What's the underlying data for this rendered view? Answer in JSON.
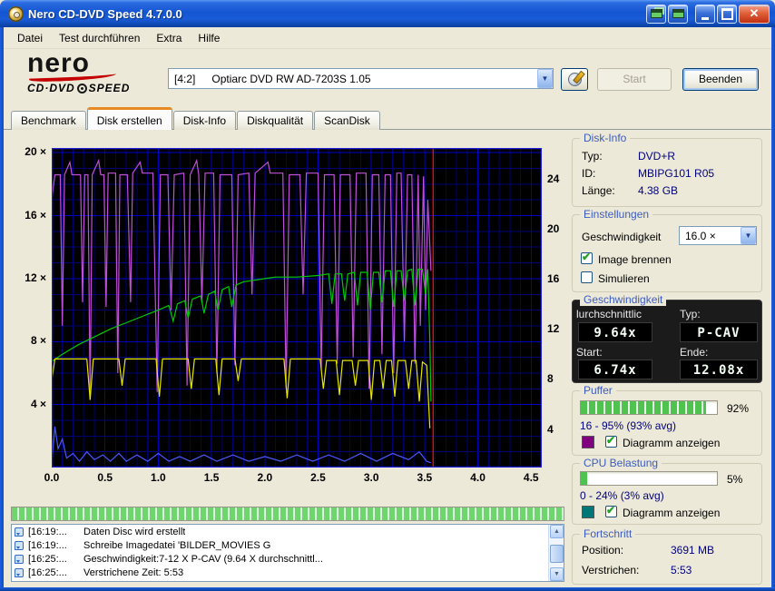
{
  "window": {
    "title": "Nero CD-DVD Speed 4.7.0.0"
  },
  "menu": {
    "items": [
      "Datei",
      "Test durchführen",
      "Extra",
      "Hilfe"
    ]
  },
  "logo": {
    "word": "nero",
    "sub_left": "CD·DVD",
    "sub_right": "SPEED"
  },
  "toolbar": {
    "drive_id": "[4:2]",
    "drive_name": "Optiarc DVD RW AD-7203S 1.05",
    "start_label": "Start",
    "quit_label": "Beenden"
  },
  "tabs": [
    {
      "label": "Benchmark"
    },
    {
      "label": "Disk erstellen"
    },
    {
      "label": "Disk-Info"
    },
    {
      "label": "Diskqualität"
    },
    {
      "label": "ScanDisk"
    }
  ],
  "chart_data": {
    "type": "line",
    "title": "",
    "xlabel": "",
    "ylabel": "",
    "xlim": [
      0,
      4.6
    ],
    "x_ticks": [
      {
        "v": 0.0,
        "label": "0.0"
      },
      {
        "v": 0.5,
        "label": "0.5"
      },
      {
        "v": 1.0,
        "label": "1.0"
      },
      {
        "v": 1.5,
        "label": "1.5"
      },
      {
        "v": 2.0,
        "label": "2.0"
      },
      {
        "v": 2.5,
        "label": "2.5"
      },
      {
        "v": 3.0,
        "label": "3.0"
      },
      {
        "v": 3.5,
        "label": "3.5"
      },
      {
        "v": 4.0,
        "label": "4.0"
      },
      {
        "v": 4.5,
        "label": "4.5"
      }
    ],
    "left_axis": {
      "lim": [
        0,
        20.3
      ],
      "ticks": [
        {
          "v": 4,
          "label": "4 ×"
        },
        {
          "v": 8,
          "label": "8 ×"
        },
        {
          "v": 12,
          "label": "12 ×"
        },
        {
          "v": 16,
          "label": "16 ×"
        },
        {
          "v": 20,
          "label": "20 ×"
        }
      ]
    },
    "right_axis": {
      "lim": [
        1.0,
        26.5
      ],
      "ticks": [
        {
          "v": 4,
          "label": "4"
        },
        {
          "v": 8,
          "label": "8"
        },
        {
          "v": 12,
          "label": "12"
        },
        {
          "v": 16,
          "label": "16"
        },
        {
          "v": 20,
          "label": "20"
        },
        {
          "v": 24,
          "label": "24"
        }
      ]
    },
    "grid": {
      "x_minor": 0.1,
      "x_major": 0.5,
      "y_minor": 1,
      "y_major": 4,
      "minor_color": "#000074",
      "major_color": "#0000c0",
      "border_color": "#2121dd"
    },
    "marker": {
      "x": 3.58,
      "color": "#ff0000"
    },
    "series": [
      {
        "name": "buffer-level",
        "color": "#c050d8",
        "points": [
          [
            0.0,
            17.0
          ],
          [
            0.03,
            18.6
          ],
          [
            0.08,
            18.6
          ],
          [
            0.1,
            9.0
          ],
          [
            0.12,
            18.6
          ],
          [
            0.17,
            19.4
          ],
          [
            0.19,
            18.6
          ],
          [
            0.27,
            18.6
          ],
          [
            0.29,
            10.5
          ],
          [
            0.31,
            18.6
          ],
          [
            0.34,
            18.6
          ],
          [
            0.36,
            4.3
          ],
          [
            0.38,
            18.6
          ],
          [
            0.44,
            19.5
          ],
          [
            0.46,
            18.6
          ],
          [
            0.49,
            18.6
          ],
          [
            0.51,
            10.2
          ],
          [
            0.53,
            18.7
          ],
          [
            0.6,
            18.7
          ],
          [
            0.62,
            6.0
          ],
          [
            0.64,
            18.6
          ],
          [
            0.71,
            18.6
          ],
          [
            0.74,
            10.5
          ],
          [
            0.76,
            18.7
          ],
          [
            0.83,
            19.4
          ],
          [
            0.85,
            18.7
          ],
          [
            0.95,
            18.7
          ],
          [
            0.99,
            4.8
          ],
          [
            1.02,
            18.6
          ],
          [
            1.09,
            18.6
          ],
          [
            1.12,
            10.0
          ],
          [
            1.15,
            18.6
          ],
          [
            1.24,
            18.7
          ],
          [
            1.27,
            5.2
          ],
          [
            1.3,
            18.6
          ],
          [
            1.36,
            19.5
          ],
          [
            1.38,
            18.6
          ],
          [
            1.41,
            10.5
          ],
          [
            1.44,
            18.7
          ],
          [
            1.52,
            18.7
          ],
          [
            1.55,
            6.0
          ],
          [
            1.58,
            18.6
          ],
          [
            1.69,
            18.6
          ],
          [
            1.72,
            6.5
          ],
          [
            1.75,
            18.6
          ],
          [
            1.85,
            18.7
          ],
          [
            1.88,
            11.0
          ],
          [
            1.91,
            18.7
          ],
          [
            2.03,
            19.4
          ],
          [
            2.05,
            18.7
          ],
          [
            2.17,
            18.7
          ],
          [
            2.2,
            5.0
          ],
          [
            2.23,
            18.6
          ],
          [
            2.33,
            18.6
          ],
          [
            2.36,
            11.0
          ],
          [
            2.39,
            18.7
          ],
          [
            2.5,
            18.7
          ],
          [
            2.53,
            6.2
          ],
          [
            2.56,
            18.6
          ],
          [
            2.65,
            18.6
          ],
          [
            2.68,
            6.6
          ],
          [
            2.71,
            18.6
          ],
          [
            2.8,
            18.6
          ],
          [
            2.83,
            7.0
          ],
          [
            2.86,
            18.7
          ],
          [
            2.95,
            18.7
          ],
          [
            2.98,
            5.0
          ],
          [
            3.01,
            18.6
          ],
          [
            3.07,
            18.6
          ],
          [
            3.1,
            7.2
          ],
          [
            3.13,
            18.6
          ],
          [
            3.18,
            18.6
          ],
          [
            3.21,
            6.0
          ],
          [
            3.24,
            18.7
          ],
          [
            3.28,
            18.7
          ],
          [
            3.31,
            8.0
          ],
          [
            3.34,
            18.6
          ],
          [
            3.38,
            18.6
          ],
          [
            3.41,
            6.6
          ],
          [
            3.44,
            18.6
          ],
          [
            3.46,
            9.0
          ],
          [
            3.49,
            18.5
          ],
          [
            3.51,
            10.0
          ],
          [
            3.53,
            17.0
          ],
          [
            3.56,
            12.5
          ]
        ]
      },
      {
        "name": "write-speed",
        "color": "#00cc00",
        "points": [
          [
            0.0,
            6.74
          ],
          [
            0.1,
            7.2
          ],
          [
            0.25,
            7.8
          ],
          [
            0.4,
            8.3
          ],
          [
            0.55,
            8.8
          ],
          [
            0.7,
            9.2
          ],
          [
            0.85,
            9.6
          ],
          [
            1.0,
            10.0
          ],
          [
            1.1,
            10.3
          ],
          [
            1.14,
            9.3
          ],
          [
            1.18,
            10.4
          ],
          [
            1.25,
            10.6
          ],
          [
            1.28,
            9.5
          ],
          [
            1.32,
            10.7
          ],
          [
            1.4,
            10.9
          ],
          [
            1.43,
            9.8
          ],
          [
            1.47,
            11.0
          ],
          [
            1.53,
            11.2
          ],
          [
            1.56,
            10.0
          ],
          [
            1.6,
            11.3
          ],
          [
            1.66,
            11.5
          ],
          [
            1.69,
            10.2
          ],
          [
            1.73,
            11.6
          ],
          [
            1.8,
            11.8
          ],
          [
            1.9,
            11.9
          ],
          [
            2.0,
            12.0
          ],
          [
            2.1,
            12.1
          ],
          [
            2.3,
            12.1
          ],
          [
            2.5,
            12.2
          ],
          [
            2.6,
            12.3
          ],
          [
            2.63,
            10.4
          ],
          [
            2.66,
            12.3
          ],
          [
            2.72,
            12.3
          ],
          [
            2.75,
            10.6
          ],
          [
            2.78,
            12.3
          ],
          [
            2.84,
            12.4
          ],
          [
            2.87,
            10.3
          ],
          [
            2.9,
            12.4
          ],
          [
            2.96,
            12.4
          ],
          [
            2.99,
            10.0
          ],
          [
            3.02,
            12.4
          ],
          [
            3.07,
            12.4
          ],
          [
            3.1,
            10.5
          ],
          [
            3.13,
            12.5
          ],
          [
            3.18,
            12.5
          ],
          [
            3.21,
            10.2
          ],
          [
            3.24,
            12.5
          ],
          [
            3.28,
            12.5
          ],
          [
            3.31,
            10.6
          ],
          [
            3.34,
            12.5
          ],
          [
            3.38,
            12.6
          ],
          [
            3.41,
            10.3
          ],
          [
            3.44,
            12.6
          ],
          [
            3.48,
            12.6
          ],
          [
            3.51,
            11.0
          ],
          [
            3.53,
            12.6
          ],
          [
            3.55,
            8.0
          ],
          [
            3.56,
            4.2
          ]
        ]
      },
      {
        "name": "read-rate",
        "color": "#e6e600",
        "points": [
          [
            0.0,
            5.5
          ],
          [
            0.03,
            6.9
          ],
          [
            0.2,
            6.9
          ],
          [
            0.33,
            6.9
          ],
          [
            0.36,
            4.3
          ],
          [
            0.39,
            6.9
          ],
          [
            0.55,
            6.9
          ],
          [
            0.63,
            6.9
          ],
          [
            0.66,
            5.2
          ],
          [
            0.69,
            6.9
          ],
          [
            0.85,
            6.9
          ],
          [
            0.98,
            6.9
          ],
          [
            1.01,
            4.5
          ],
          [
            1.04,
            6.9
          ],
          [
            1.2,
            6.9
          ],
          [
            1.28,
            6.9
          ],
          [
            1.31,
            5.0
          ],
          [
            1.34,
            6.9
          ],
          [
            1.5,
            6.9
          ],
          [
            1.54,
            6.9
          ],
          [
            1.57,
            4.6
          ],
          [
            1.6,
            6.9
          ],
          [
            1.72,
            6.9
          ],
          [
            1.75,
            5.5
          ],
          [
            1.78,
            6.9
          ],
          [
            2.0,
            6.9
          ],
          [
            2.18,
            6.9
          ],
          [
            2.21,
            4.4
          ],
          [
            2.24,
            6.9
          ],
          [
            2.4,
            6.9
          ],
          [
            2.52,
            6.9
          ],
          [
            2.55,
            5.0
          ],
          [
            2.58,
            6.8
          ],
          [
            2.67,
            6.8
          ],
          [
            2.7,
            4.6
          ],
          [
            2.73,
            6.8
          ],
          [
            2.82,
            6.8
          ],
          [
            2.85,
            5.2
          ],
          [
            2.88,
            6.8
          ],
          [
            2.97,
            6.8
          ],
          [
            3.0,
            4.3
          ],
          [
            3.03,
            6.8
          ],
          [
            3.08,
            6.8
          ],
          [
            3.11,
            5.0
          ],
          [
            3.14,
            6.8
          ],
          [
            3.19,
            6.8
          ],
          [
            3.22,
            4.5
          ],
          [
            3.25,
            6.8
          ],
          [
            3.32,
            6.8
          ],
          [
            3.35,
            5.0
          ],
          [
            3.38,
            6.8
          ],
          [
            3.42,
            6.8
          ],
          [
            3.45,
            4.2
          ],
          [
            3.48,
            6.7
          ],
          [
            3.52,
            6.5
          ],
          [
            3.55,
            2.5
          ]
        ]
      },
      {
        "name": "cpu-usage",
        "color": "#4858ff",
        "points": [
          [
            0.0,
            0.3
          ],
          [
            0.03,
            2.6
          ],
          [
            0.06,
            1.2
          ],
          [
            0.1,
            1.8
          ],
          [
            0.14,
            0.6
          ],
          [
            0.2,
            0.9
          ],
          [
            0.26,
            0.4
          ],
          [
            0.33,
            1.0
          ],
          [
            0.4,
            0.5
          ],
          [
            0.48,
            0.8
          ],
          [
            0.55,
            0.4
          ],
          [
            0.63,
            0.9
          ],
          [
            0.7,
            0.4
          ],
          [
            0.8,
            0.8
          ],
          [
            0.9,
            0.4
          ],
          [
            1.0,
            0.9
          ],
          [
            1.1,
            0.4
          ],
          [
            1.2,
            0.7
          ],
          [
            1.3,
            0.4
          ],
          [
            1.43,
            0.8
          ],
          [
            1.55,
            0.4
          ],
          [
            1.7,
            0.8
          ],
          [
            1.85,
            0.4
          ],
          [
            2.0,
            0.7
          ],
          [
            2.15,
            0.4
          ],
          [
            2.3,
            0.8
          ],
          [
            2.45,
            0.4
          ],
          [
            2.6,
            0.8
          ],
          [
            2.75,
            0.4
          ],
          [
            2.9,
            0.9
          ],
          [
            3.05,
            0.4
          ],
          [
            3.2,
            0.9
          ],
          [
            3.35,
            0.5
          ],
          [
            3.45,
            1.0
          ],
          [
            3.52,
            0.4
          ],
          [
            3.56,
            0.3
          ]
        ]
      }
    ]
  },
  "disk_info": {
    "title": "Disk-Info",
    "rows": [
      {
        "label": "Typ:",
        "value": "DVD+R"
      },
      {
        "label": "ID:",
        "value": "MBIPG101 R05"
      },
      {
        "label": "Länge:",
        "value": "4.38 GB"
      }
    ]
  },
  "settings": {
    "title": "Einstellungen",
    "speed_label": "Geschwindigkeit",
    "speed_value": "16.0 ×",
    "image_burn": "Image brennen",
    "simulate": "Simulieren"
  },
  "speed": {
    "title": "Geschwindigkeit",
    "avg_label": "lurchschnittlic",
    "type_label": "Typ:",
    "avg_value": "9.64x",
    "type_value": "P-CAV",
    "start_label": "Start:",
    "end_label": "Ende:",
    "start_value": "6.74x",
    "end_value": "12.08x"
  },
  "buffer": {
    "title": "Puffer",
    "percent": "92%",
    "value": 92,
    "range": "16 - 95% (93% avg)",
    "checkbox": "Diagramm anzeigen",
    "swatch": "#800080"
  },
  "cpu": {
    "title": "CPU Belastung",
    "percent": "5%",
    "value": 5,
    "range": "0 - 24% (3% avg)",
    "checkbox": "Diagramm anzeigen",
    "swatch": "#007878"
  },
  "progress": {
    "title": "Fortschritt",
    "position_label": "Position:",
    "position_value": "3691 MB",
    "elapsed_label": "Verstrichen:",
    "elapsed_value": "5:53",
    "overall_percent": 100
  },
  "log": {
    "items": [
      {
        "time": "[16:19:...",
        "text": "Daten Disc wird erstellt"
      },
      {
        "time": "[16:19:...",
        "text": "Schreibe Imagedatei 'BILDER_MOVIES G"
      },
      {
        "time": "[16:25:...",
        "text": "Geschwindigkeit:7-12 X P-CAV (9.64 X durchschnittl..."
      },
      {
        "time": "[16:25:...",
        "text": "Verstrichene Zeit: 5:53"
      }
    ]
  }
}
